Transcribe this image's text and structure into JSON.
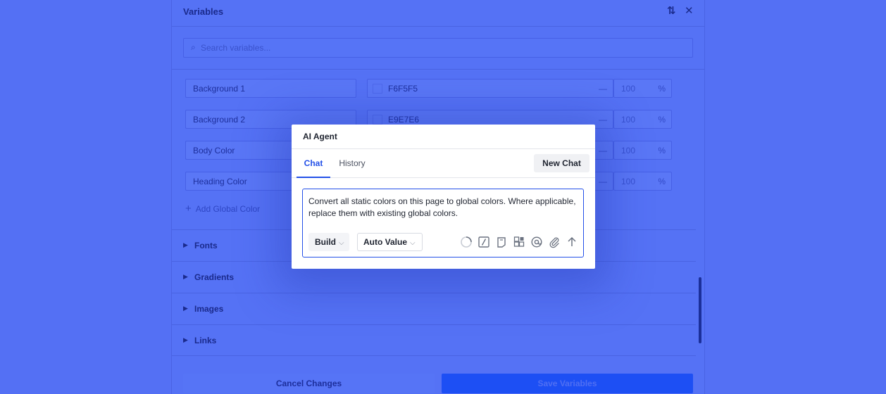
{
  "panel": {
    "title": "Variables",
    "search_placeholder": "Search variables...",
    "variables": [
      {
        "name": "Background 1",
        "hex": "F6F5F5",
        "opacity": "100",
        "unit": "%"
      },
      {
        "name": "Background 2",
        "hex": "E9E7E6",
        "opacity": "100",
        "unit": "%"
      },
      {
        "name": "Body Color",
        "hex": "",
        "opacity": "100",
        "unit": "%"
      },
      {
        "name": "Heading Color",
        "hex": "",
        "opacity": "100",
        "unit": "%"
      }
    ],
    "add_global_label": "Add Global Color",
    "sections": [
      "Fonts",
      "Gradients",
      "Images",
      "Links"
    ],
    "cancel_label": "Cancel Changes",
    "save_label": "Save Variables"
  },
  "modal": {
    "title": "AI Agent",
    "tabs": [
      "Chat",
      "History"
    ],
    "new_chat_label": "New Chat",
    "prompt": "Convert all static colors on this page to global colors. Where applicable, replace them with existing global colors.",
    "mode_select": "Build",
    "value_select": "Auto Value"
  },
  "colors": {
    "overlay": "#5470f4",
    "accent": "#2350e8"
  },
  "icons": [
    "sort-icon",
    "close-icon",
    "search-icon",
    "plus-icon",
    "caret-right-icon",
    "chevron-down-icon",
    "spinner-icon",
    "slash-command-icon",
    "page-icon",
    "blocks-icon",
    "at-icon",
    "paperclip-icon",
    "send-arrow-icon"
  ]
}
